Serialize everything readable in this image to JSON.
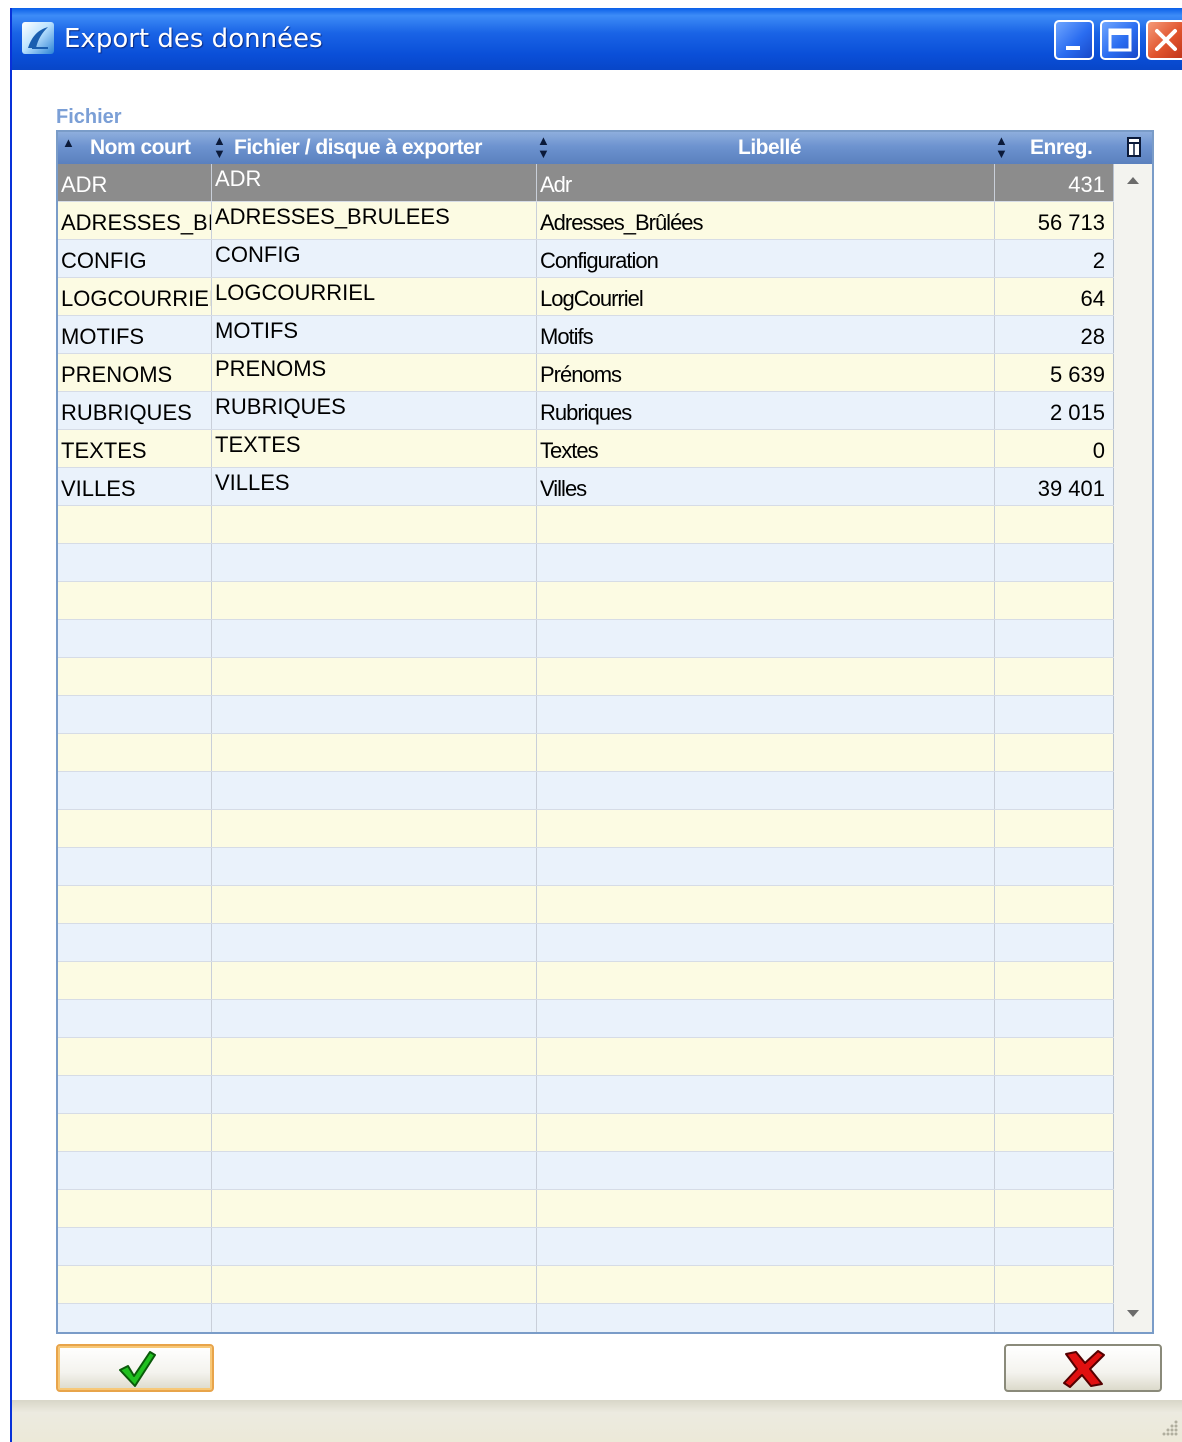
{
  "window": {
    "title": "Export des données",
    "minimize_icon": "minimize-icon",
    "maximize_icon": "maximize-icon",
    "close_icon": "close-icon"
  },
  "section": {
    "label": "Fichier"
  },
  "table": {
    "columns": [
      "Nom court",
      "Fichier / disque à exporter",
      "Libellé",
      "Enreg."
    ],
    "sort_column": "Nom court",
    "rows": [
      {
        "nom": "ADR",
        "fichier": "ADR",
        "libelle": "Adr",
        "enreg": "431"
      },
      {
        "nom": "ADRESSES_BI",
        "fichier": "ADRESSES_BRULEES",
        "libelle": "Adresses_Brûlées",
        "enreg": "56 713"
      },
      {
        "nom": "CONFIG",
        "fichier": "CONFIG",
        "libelle": "Configuration",
        "enreg": "2"
      },
      {
        "nom": "LOGCOURRIEI",
        "fichier": "LOGCOURRIEL",
        "libelle": "LogCourriel",
        "enreg": "64"
      },
      {
        "nom": "MOTIFS",
        "fichier": "MOTIFS",
        "libelle": "Motifs",
        "enreg": "28"
      },
      {
        "nom": "PRENOMS",
        "fichier": "PRENOMS",
        "libelle": "Prénoms",
        "enreg": "5 639"
      },
      {
        "nom": "RUBRIQUES",
        "fichier": "RUBRIQUES",
        "libelle": "Rubriques",
        "enreg": "2 015"
      },
      {
        "nom": "TEXTES",
        "fichier": "TEXTES",
        "libelle": "Textes",
        "enreg": "0"
      },
      {
        "nom": "VILLES",
        "fichier": "VILLES",
        "libelle": "Villes",
        "enreg": "39 401"
      }
    ],
    "selected_row": 0
  },
  "buttons": {
    "ok_icon": "checkmark-icon",
    "cancel_icon": "red-x-icon"
  },
  "colors": {
    "titlebar": "#0a4fd8",
    "header": "#6d93cf",
    "row_even": "#eaf2fb",
    "row_odd": "#fcfbe3",
    "selected": "#8c8c8c",
    "ok_border": "#e8a44a",
    "cancel_x": "#e01010"
  }
}
